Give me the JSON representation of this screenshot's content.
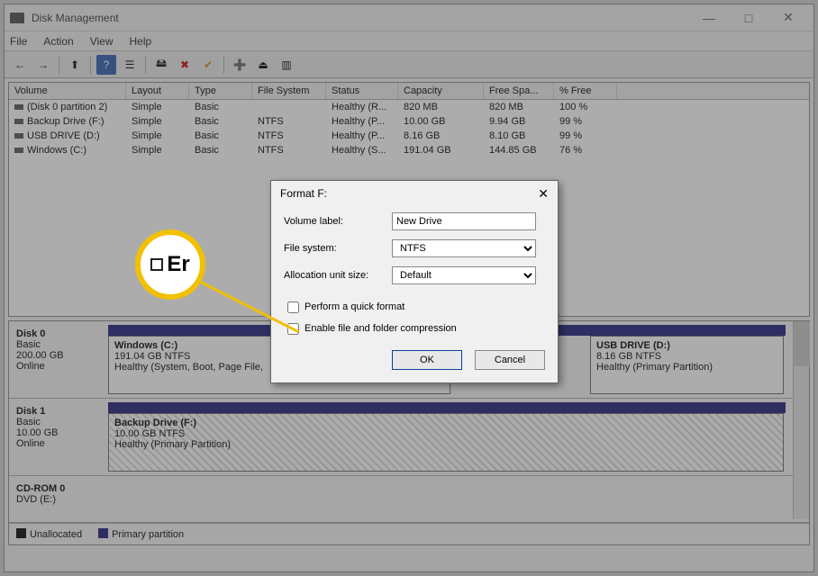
{
  "window": {
    "title": "Disk Management"
  },
  "menu": {
    "file": "File",
    "action": "Action",
    "view": "View",
    "help": "Help"
  },
  "toolbar": {
    "back": "←",
    "fwd": "→",
    "up": "⬆",
    "refresh": "?",
    "props": "☰",
    "connect": "🖴",
    "delete": "✖",
    "checkmark": "✔",
    "new": "➕",
    "eject": "⏏",
    "more": "▥"
  },
  "win_controls": {
    "min": "—",
    "max": "□",
    "close": "✕"
  },
  "cols": {
    "volume": "Volume",
    "layout": "Layout",
    "type": "Type",
    "filesystem": "File System",
    "status": "Status",
    "capacity": "Capacity",
    "freespace": "Free Spa...",
    "pctfree": "% Free"
  },
  "rows": [
    {
      "volume": "(Disk 0 partition 2)",
      "layout": "Simple",
      "type": "Basic",
      "fs": "",
      "status": "Healthy (R...",
      "capacity": "820 MB",
      "free": "820 MB",
      "pct": "100 %"
    },
    {
      "volume": "Backup Drive (F:)",
      "layout": "Simple",
      "type": "Basic",
      "fs": "NTFS",
      "status": "Healthy (P...",
      "capacity": "10.00 GB",
      "free": "9.94 GB",
      "pct": "99 %"
    },
    {
      "volume": "USB DRIVE (D:)",
      "layout": "Simple",
      "type": "Basic",
      "fs": "NTFS",
      "status": "Healthy (P...",
      "capacity": "8.16 GB",
      "free": "8.10 GB",
      "pct": "99 %"
    },
    {
      "volume": "Windows (C:)",
      "layout": "Simple",
      "type": "Basic",
      "fs": "NTFS",
      "status": "Healthy (S...",
      "capacity": "191.04 GB",
      "free": "144.85 GB",
      "pct": "76 %"
    }
  ],
  "disks": {
    "d0": {
      "name": "Disk 0",
      "sub1": "Basic",
      "sub2": "200.00 GB",
      "sub3": "Online"
    },
    "d0p1": {
      "name": "Windows  (C:)",
      "l2": "191.04 GB NTFS",
      "l3": "Healthy (System, Boot, Page File,"
    },
    "d0p2": {
      "name": "USB DRIVE  (D:)",
      "l2": "8.16 GB NTFS",
      "l3": "Healthy (Primary Partition)"
    },
    "d1": {
      "name": "Disk 1",
      "sub1": "Basic",
      "sub2": "10.00 GB",
      "sub3": "Online"
    },
    "d1p1": {
      "name": "Backup Drive  (F:)",
      "l2": "10.00 GB NTFS",
      "l3": "Healthy (Primary Partition)"
    },
    "cd": {
      "name": "CD-ROM 0",
      "sub1": "DVD (E:)"
    }
  },
  "legend": {
    "unalloc": "Unallocated",
    "primary": "Primary partition"
  },
  "dialog": {
    "title": "Format F:",
    "vol_lbl": "Volume label:",
    "vol_val": "New Drive",
    "fs_lbl": "File system:",
    "fs_val": "NTFS",
    "au_lbl": "Allocation unit size:",
    "au_val": "Default",
    "quick": "Perform a quick format",
    "compress": "Enable file and folder compression",
    "ok": "OK",
    "cancel": "Cancel"
  },
  "callout": {
    "text": "Er"
  }
}
